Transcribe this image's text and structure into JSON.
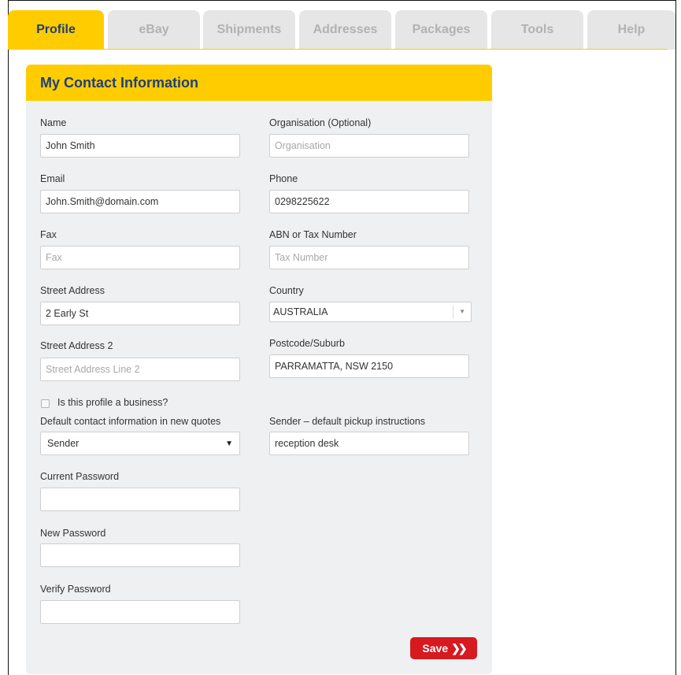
{
  "tabs": [
    {
      "label": "Profile",
      "active": true
    },
    {
      "label": "eBay",
      "active": false
    },
    {
      "label": "Shipments",
      "active": false
    },
    {
      "label": "Addresses",
      "active": false
    },
    {
      "label": "Packages",
      "active": false
    },
    {
      "label": "Tools",
      "active": false
    },
    {
      "label": "Help",
      "active": false
    }
  ],
  "panel": {
    "title": "My Contact Information",
    "name": {
      "label": "Name",
      "value": "John Smith",
      "placeholder": ""
    },
    "organisation": {
      "label": "Organisation (Optional)",
      "value": "",
      "placeholder": "Organisation"
    },
    "email": {
      "label": "Email",
      "value": "John.Smith@domain.com",
      "placeholder": ""
    },
    "phone": {
      "label": "Phone",
      "value": "0298225622",
      "placeholder": ""
    },
    "fax": {
      "label": "Fax",
      "value": "",
      "placeholder": "Fax"
    },
    "abn": {
      "label": "ABN or Tax Number",
      "value": "",
      "placeholder": "Tax Number"
    },
    "street": {
      "label": "Street Address",
      "value": "2 Early St",
      "placeholder": ""
    },
    "country": {
      "label": "Country",
      "selected": "AUSTRALIA"
    },
    "street2": {
      "label": "Street Address 2",
      "value": "",
      "placeholder": "Street Address Line 2"
    },
    "postcode": {
      "label": "Postcode/Suburb",
      "value": "PARRAMATTA, NSW 2150",
      "placeholder": ""
    },
    "business": {
      "label": "Is this profile a business?",
      "checked": false
    },
    "default_contact": {
      "label": "Default contact information in new quotes",
      "selected": "Sender"
    },
    "pickup": {
      "label": "Sender – default pickup instructions",
      "value": "reception desk",
      "placeholder": ""
    },
    "current_password": {
      "label": "Current Password",
      "value": ""
    },
    "new_password": {
      "label": "New Password",
      "value": ""
    },
    "verify_password": {
      "label": "Verify Password",
      "value": ""
    },
    "save_label": "Save",
    "save_arrow": "❯❯"
  },
  "colors": {
    "accent": "#ffcc00",
    "title_blue": "#1f3f7a",
    "save_red": "#d71920",
    "panel_bg": "#eff0f2",
    "tab_inactive": "#e6e6e6"
  }
}
